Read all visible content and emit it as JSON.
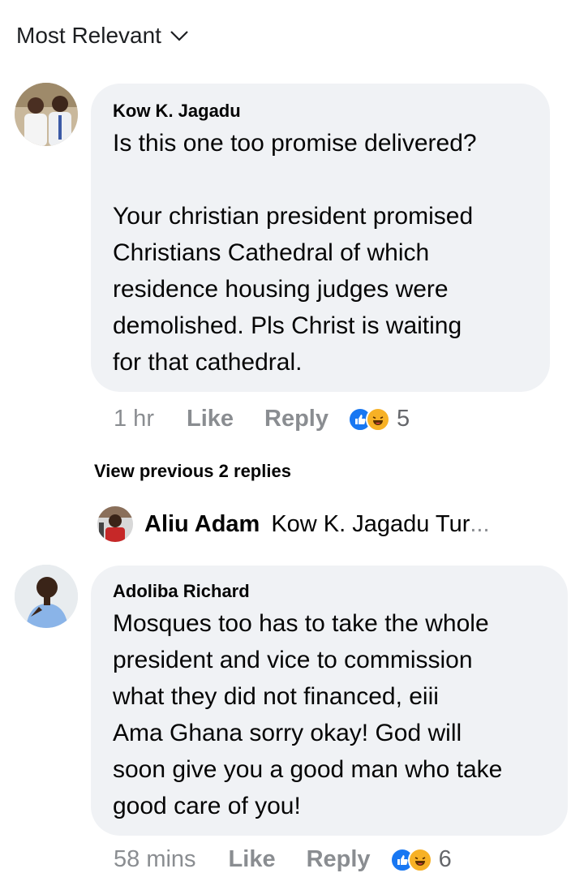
{
  "header": {
    "sort_label": "Most Relevant"
  },
  "comments": [
    {
      "author": "Kow K. Jagadu",
      "text": "Is this one too promise delivered?\n\nYour christian president promised\nChristians Cathedral of which\nresidence housing judges were\ndemolished. Pls Christ is waiting\nfor that cathedral.",
      "time": "1 hr",
      "like_label": "Like",
      "reply_label": "Reply",
      "reaction_count": "5"
    },
    {
      "author": "Adoliba Richard",
      "text": "Mosques too has to take the whole\npresident and vice to commission\nwhat they did not financed,  eiii\nAma Ghana sorry okay! God will\nsoon give you a good man who take\ngood care of you!",
      "time": "58 mins",
      "like_label": "Like",
      "reply_label": "Reply",
      "reaction_count": "6"
    }
  ],
  "replies": {
    "view_previous_label": "View previous 2 replies",
    "latest": {
      "author": "Aliu Adam",
      "snippet": "Kow K. Jagadu  Tur",
      "ellipsis": "..."
    }
  },
  "colors": {
    "bubble": "#f0f2f5",
    "like_blue": "#1877f2",
    "haha_yellow": "#f7b125",
    "muted": "#65676b"
  }
}
